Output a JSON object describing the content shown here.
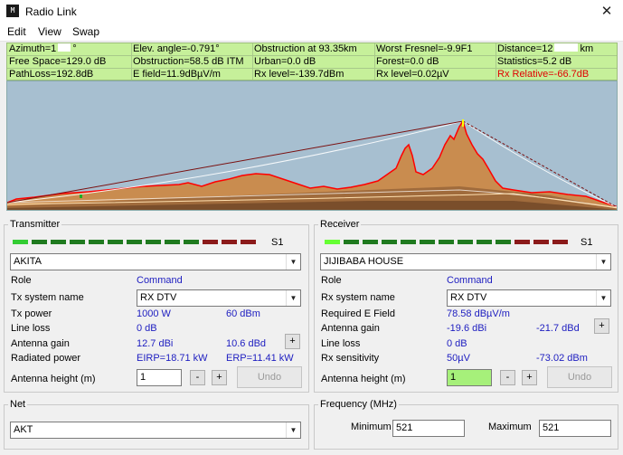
{
  "window": {
    "icon": "M",
    "title": "Radio Link",
    "close": "✕"
  },
  "menu": [
    "Edit",
    "View",
    "Swap"
  ],
  "info": {
    "row1": [
      "Azimuth=1",
      "Elev. angle=-0.791°",
      "Obstruction at 93.35km",
      "Worst Fresnel=-9.9F1",
      "Distance=12",
      "km"
    ],
    "row2": [
      "Free Space=129.0 dB",
      "Obstruction=58.5 dB ITM",
      "Urban=0.0 dB",
      "Forest=0.0 dB",
      "Statistics=5.2 dB"
    ],
    "row3": [
      "PathLoss=192.8dB",
      "E field=11.9dBµV/m",
      "Rx level=-139.7dBm",
      "Rx level=0.02µV",
      "Rx Relative=-66.7dB"
    ],
    "azimuth_symbol": "°",
    "highlight_color": "#e00000"
  },
  "transmitter": {
    "legend": "Transmitter",
    "meter_label": "S1",
    "meter_colors": [
      "#33cc33",
      "#1f7a1f",
      "#1f7a1f",
      "#1f7a1f",
      "#1f7a1f",
      "#1f7a1f",
      "#1f7a1f",
      "#1f7a1f",
      "#1f7a1f",
      "#1f7a1f",
      "#8b1a1a",
      "#8b1a1a",
      "#8b1a1a"
    ],
    "station": "AKITA",
    "role_label": "Role",
    "role_value": "Command",
    "system_label": "Tx system name",
    "system_value": "RX DTV",
    "power_label": "Tx power",
    "power_w": "1000 W",
    "power_dbm": "60 dBm",
    "line_loss_label": "Line loss",
    "line_loss": "0 dB",
    "gain_label": "Antenna gain",
    "gain_dbi": "12.7 dBi",
    "gain_dbd": "10.6 dBd",
    "plus": "+",
    "radiated_label": "Radiated power",
    "eirp": "EIRP=18.71 kW",
    "erp": "ERP=11.41 kW",
    "height_label": "Antenna height (m)",
    "height": "1",
    "minus": "-",
    "undo": "Undo"
  },
  "receiver": {
    "legend": "Receiver",
    "meter_label": "S1",
    "meter_colors": [
      "#66ff33",
      "#1f7a1f",
      "#1f7a1f",
      "#1f7a1f",
      "#1f7a1f",
      "#1f7a1f",
      "#1f7a1f",
      "#1f7a1f",
      "#1f7a1f",
      "#1f7a1f",
      "#8b1a1a",
      "#8b1a1a",
      "#8b1a1a"
    ],
    "station": "JIJIBABA HOUSE",
    "role_label": "Role",
    "role_value": "Command",
    "system_label": "Rx system name",
    "system_value": "RX DTV",
    "efield_label": "Required E Field",
    "efield": "78.58 dBµV/m",
    "gain_label": "Antenna gain",
    "gain_dbi": "-19.6 dBi",
    "gain_dbd": "-21.7 dBd",
    "plus": "+",
    "line_loss_label": "Line loss",
    "line_loss": "0 dB",
    "sens_label": "Rx sensitivity",
    "sens_uv": "50µV",
    "sens_dbm": "-73.02 dBm",
    "height_label": "Antenna height (m)",
    "height": "1",
    "minus": "-",
    "undo": "Undo"
  },
  "net": {
    "legend": "Net",
    "value": "AKT"
  },
  "frequency": {
    "legend": "Frequency (MHz)",
    "min_label": "Minimum",
    "min": "521",
    "max_label": "Maximum",
    "max": "521"
  },
  "colors": {
    "info_bg": "#c6f09a",
    "sky": "#a7bfd0",
    "terrain": "#c98c4f",
    "terrain_edge": "#ff0000",
    "ray": "#8b0000"
  }
}
